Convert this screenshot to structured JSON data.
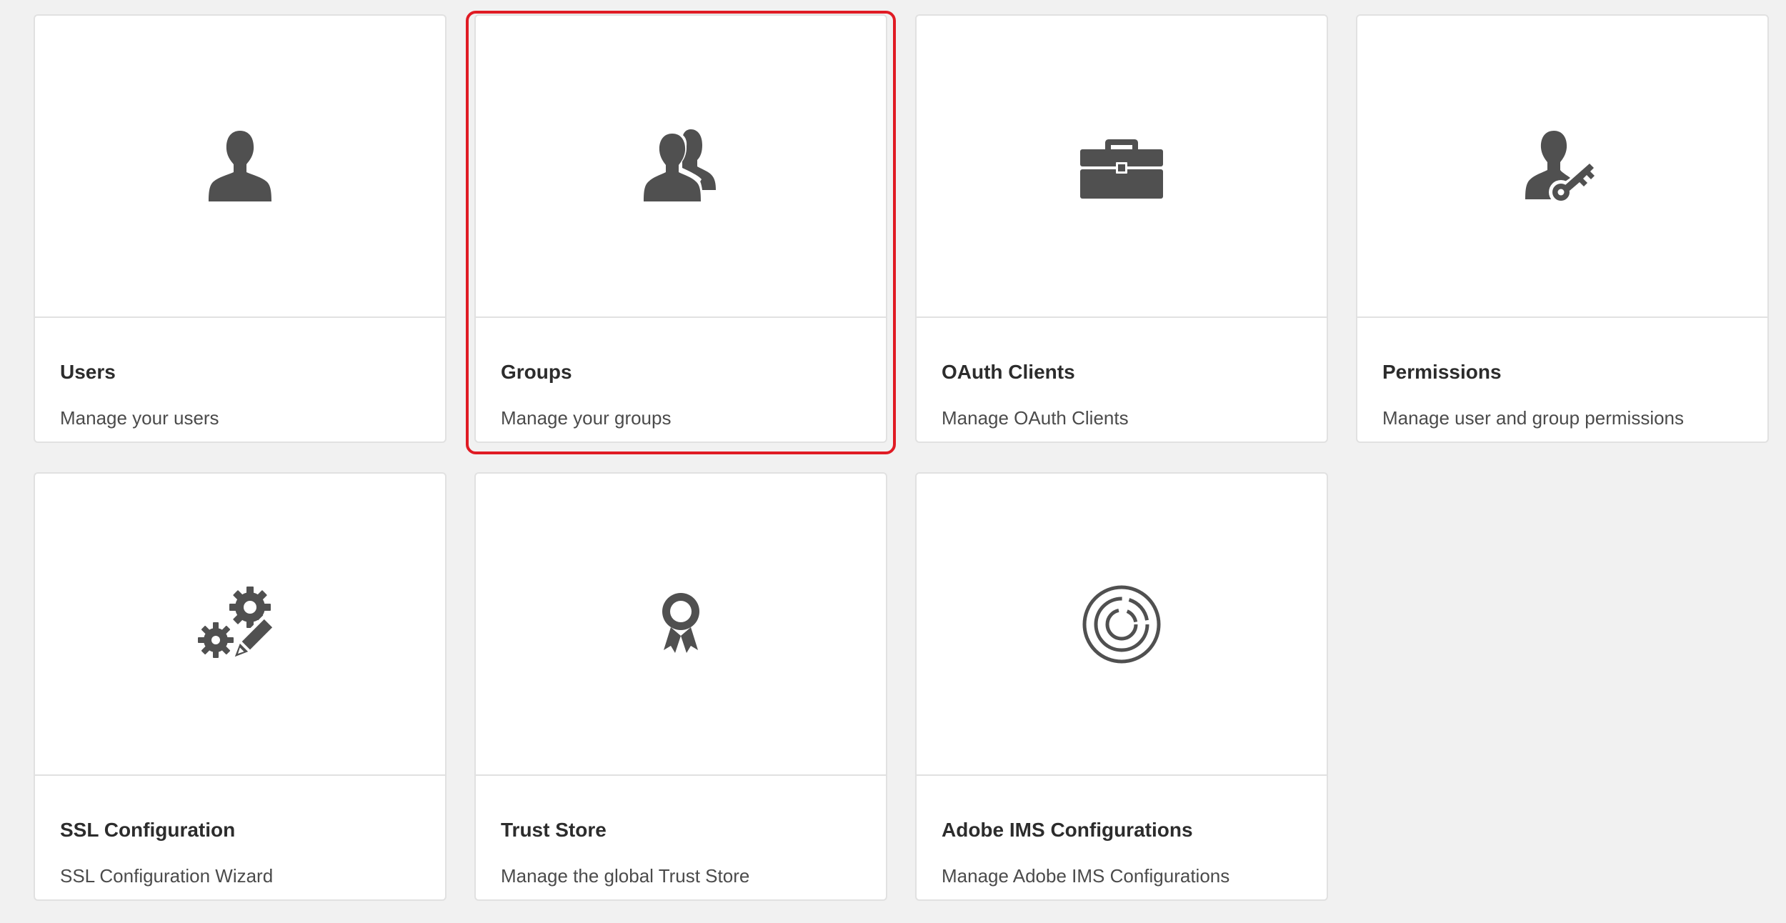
{
  "colors": {
    "background": "#f1f1f1",
    "card": "#ffffff",
    "icon": "#505050",
    "highlight": "#e01b24"
  },
  "cards": [
    {
      "title": "Users",
      "description": "Manage your users",
      "icon": "user-icon"
    },
    {
      "title": "Groups",
      "description": "Manage your groups",
      "icon": "groups-icon",
      "highlighted": true
    },
    {
      "title": "OAuth Clients",
      "description": "Manage OAuth Clients",
      "icon": "toolbox-icon"
    },
    {
      "title": "Permissions",
      "description": "Manage user and group permissions",
      "icon": "user-key-icon"
    },
    {
      "title": "SSL Configuration",
      "description": "SSL Configuration Wizard",
      "icon": "gears-pencil-icon"
    },
    {
      "title": "Trust Store",
      "description": "Manage the global Trust Store",
      "icon": "award-ribbon-icon"
    },
    {
      "title": "Adobe IMS Configurations",
      "description": "Manage Adobe IMS Configurations",
      "icon": "ims-rings-icon"
    }
  ]
}
